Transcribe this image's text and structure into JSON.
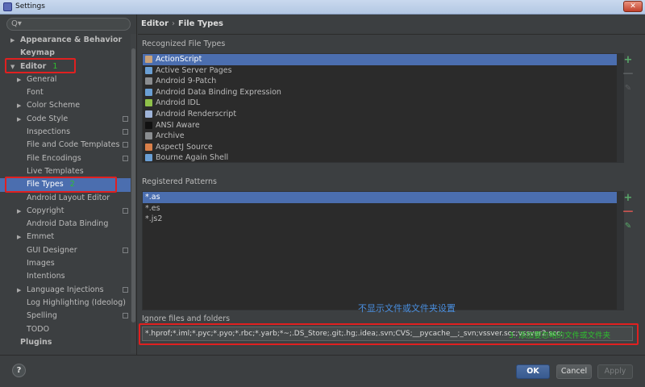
{
  "window": {
    "title": "Settings",
    "close_glyph": "✕"
  },
  "search": {
    "icon": "search-icon",
    "glyph": "Q▾"
  },
  "sidebar": {
    "items": [
      {
        "label": "Appearance & Behavior",
        "level": 0,
        "arrow": "▶",
        "project": false
      },
      {
        "label": "Keymap",
        "level": 0,
        "arrow": "",
        "project": false
      },
      {
        "label": "Editor",
        "level": 0,
        "arrow": "▼",
        "project": false,
        "annotation": "1"
      },
      {
        "label": "General",
        "level": 1,
        "arrow": "▶",
        "project": false
      },
      {
        "label": "Font",
        "level": 1,
        "arrow": "",
        "project": false
      },
      {
        "label": "Color Scheme",
        "level": 1,
        "arrow": "▶",
        "project": false
      },
      {
        "label": "Code Style",
        "level": 1,
        "arrow": "▶",
        "project": true
      },
      {
        "label": "Inspections",
        "level": 1,
        "arrow": "",
        "project": true
      },
      {
        "label": "File and Code Templates",
        "level": 1,
        "arrow": "",
        "project": true
      },
      {
        "label": "File Encodings",
        "level": 1,
        "arrow": "",
        "project": true
      },
      {
        "label": "Live Templates",
        "level": 1,
        "arrow": "",
        "project": false
      },
      {
        "label": "File Types",
        "level": 1,
        "arrow": "",
        "project": false,
        "selected": true,
        "annotation": "2"
      },
      {
        "label": "Android Layout Editor",
        "level": 1,
        "arrow": "",
        "project": false
      },
      {
        "label": "Copyright",
        "level": 1,
        "arrow": "▶",
        "project": true
      },
      {
        "label": "Android Data Binding",
        "level": 1,
        "arrow": "",
        "project": false
      },
      {
        "label": "Emmet",
        "level": 1,
        "arrow": "▶",
        "project": false
      },
      {
        "label": "GUI Designer",
        "level": 1,
        "arrow": "",
        "project": true
      },
      {
        "label": "Images",
        "level": 1,
        "arrow": "",
        "project": false
      },
      {
        "label": "Intentions",
        "level": 1,
        "arrow": "",
        "project": false
      },
      {
        "label": "Language Injections",
        "level": 1,
        "arrow": "▶",
        "project": true
      },
      {
        "label": "Log Highlighting (Ideolog)",
        "level": 1,
        "arrow": "",
        "project": false
      },
      {
        "label": "Spelling",
        "level": 1,
        "arrow": "",
        "project": true
      },
      {
        "label": "TODO",
        "level": 1,
        "arrow": "",
        "project": false
      },
      {
        "label": "Plugins",
        "level": 0,
        "arrow": "",
        "project": false
      }
    ]
  },
  "breadcrumb": {
    "parent": "Editor",
    "separator": "›",
    "current": "File Types"
  },
  "recognized": {
    "label": "Recognized File Types",
    "items": [
      {
        "label": "ActionScript",
        "icon_color": "#c9a27a",
        "selected": true
      },
      {
        "label": "Active Server Pages",
        "icon_color": "#6a9fd4"
      },
      {
        "label": "Android 9-Patch",
        "icon_color": "#8a8d90"
      },
      {
        "label": "Android Data Binding Expression",
        "icon_color": "#6a9fd4"
      },
      {
        "label": "Android IDL",
        "icon_color": "#8fc14a"
      },
      {
        "label": "Android Renderscript",
        "icon_color": "#9fb4d8"
      },
      {
        "label": "ANSI Aware",
        "icon_color": "#111111"
      },
      {
        "label": "Archive",
        "icon_color": "#8a8d90"
      },
      {
        "label": "AspectJ Source",
        "icon_color": "#d9804a"
      },
      {
        "label": "Bourne Again Shell",
        "icon_color": "#6a9fd4"
      }
    ]
  },
  "patterns": {
    "label": "Registered Patterns",
    "items": [
      {
        "label": "*.as",
        "selected": true
      },
      {
        "label": "*.es"
      },
      {
        "label": "*.js2"
      }
    ]
  },
  "buttons_glyphs": {
    "add": "+",
    "remove": "—",
    "edit": "✎"
  },
  "caption": "不显示文件或文件夹设置",
  "ignore": {
    "label": "Ignore files and folders",
    "value": "*.hprof;*.iml;*.pyc;*.pyo;*.rbc;*.yarb;*~;.DS_Store;.git;.hg;.idea;.svn;CVS;__pycache__;_svn;vssver.scc;vssver2.scc;",
    "note": "3. 添加要忽略的文件或文件夹"
  },
  "footer": {
    "help": "?",
    "ok": "OK",
    "cancel": "Cancel",
    "apply": "Apply"
  },
  "colors": {
    "accent": "#4b6eaf",
    "annotation_green": "#2fbf2f",
    "highlight_red": "#e02020",
    "caption_blue": "#4a8fe0"
  }
}
